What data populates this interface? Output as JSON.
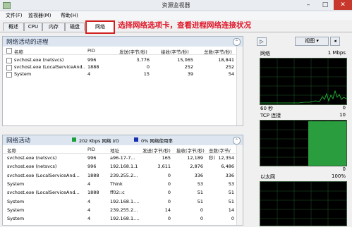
{
  "window": {
    "title": "资源监视器",
    "minimize": "–",
    "maximize": "□",
    "close": "✕"
  },
  "menu": [
    "文件(F)",
    "监视器(M)",
    "帮助(H)"
  ],
  "tabs": [
    "概述",
    "CPU",
    "内存",
    "磁盘",
    "网络"
  ],
  "active_tab_index": 4,
  "annotation": "选择网络选项卡，查看进程网络连接状况",
  "process_panel": {
    "title": "网络活动的进程",
    "collapse_icon": "⌃",
    "columns": [
      "名称",
      "PID",
      "发送(字节/秒)",
      "接收(字节/秒)",
      "总数(字节/秒)"
    ],
    "rows": [
      {
        "name": "svchost.exe (netsvcs)",
        "pid": "996",
        "send": "3,776",
        "recv": "15,065",
        "total": "18,841"
      },
      {
        "name": "svchost.exe (LocalServiceAnd...",
        "pid": "1888",
        "send": "0",
        "recv": "252",
        "total": "252"
      },
      {
        "name": "System",
        "pid": "4",
        "send": "15",
        "recv": "39",
        "total": "54"
      }
    ]
  },
  "activity_panel": {
    "title": "网络活动",
    "io_legend": "202 Kbps 网络 I/O",
    "io_color": "#19a03a",
    "util_legend": "0% 网络使用率",
    "util_color": "#1a2fae",
    "collapse_icon": "⌃",
    "columns": [
      "名称",
      "PID",
      "地址",
      "发送(字节/秒)",
      "接收(字节/秒)",
      "总数(字节/秒)"
    ],
    "rows": [
      {
        "name": "svchost.exe (netsvcs)",
        "pid": "996",
        "addr": "a96-17-7...",
        "send": "165",
        "recv": "12,189",
        "total": "12,354"
      },
      {
        "name": "svchost.exe (netsvcs)",
        "pid": "996",
        "addr": "192.168.1.1",
        "send": "3,611",
        "recv": "2,876",
        "total": "6,486"
      },
      {
        "name": "svchost.exe (LocalServiceAnd...",
        "pid": "1888",
        "addr": "239.255.2...",
        "send": "0",
        "recv": "336",
        "total": "336"
      },
      {
        "name": "System",
        "pid": "4",
        "addr": "Think",
        "send": "0",
        "recv": "53",
        "total": "53"
      },
      {
        "name": "svchost.exe (LocalServiceAnd...",
        "pid": "1888",
        "addr": "ff02::c",
        "send": "0",
        "recv": "51",
        "total": "51"
      },
      {
        "name": "System",
        "pid": "4",
        "addr": "192.168.1....",
        "send": "0",
        "recv": "51",
        "total": "51"
      },
      {
        "name": "System",
        "pid": "4",
        "addr": "239.255.2...",
        "send": "14",
        "recv": "0",
        "total": "14"
      },
      {
        "name": "System",
        "pid": "4",
        "addr": "192.168.1....",
        "send": "0",
        "recv": "0",
        "total": "0"
      }
    ]
  },
  "right_panel": {
    "expand_icon": "▷",
    "view_button": "视图",
    "view_dropdown_icon": "▾",
    "nav_icon": "◂",
    "graphs": [
      {
        "title": "网络",
        "value": "1 Mbps",
        "bottom_left": "60 秒",
        "bottom_right": "0"
      },
      {
        "title": "TCP 连接",
        "value": "10",
        "bottom_left": "",
        "bottom_right": "0"
      },
      {
        "title": "以太网",
        "value": "100%",
        "bottom_left": "",
        "bottom_right": ""
      }
    ]
  }
}
